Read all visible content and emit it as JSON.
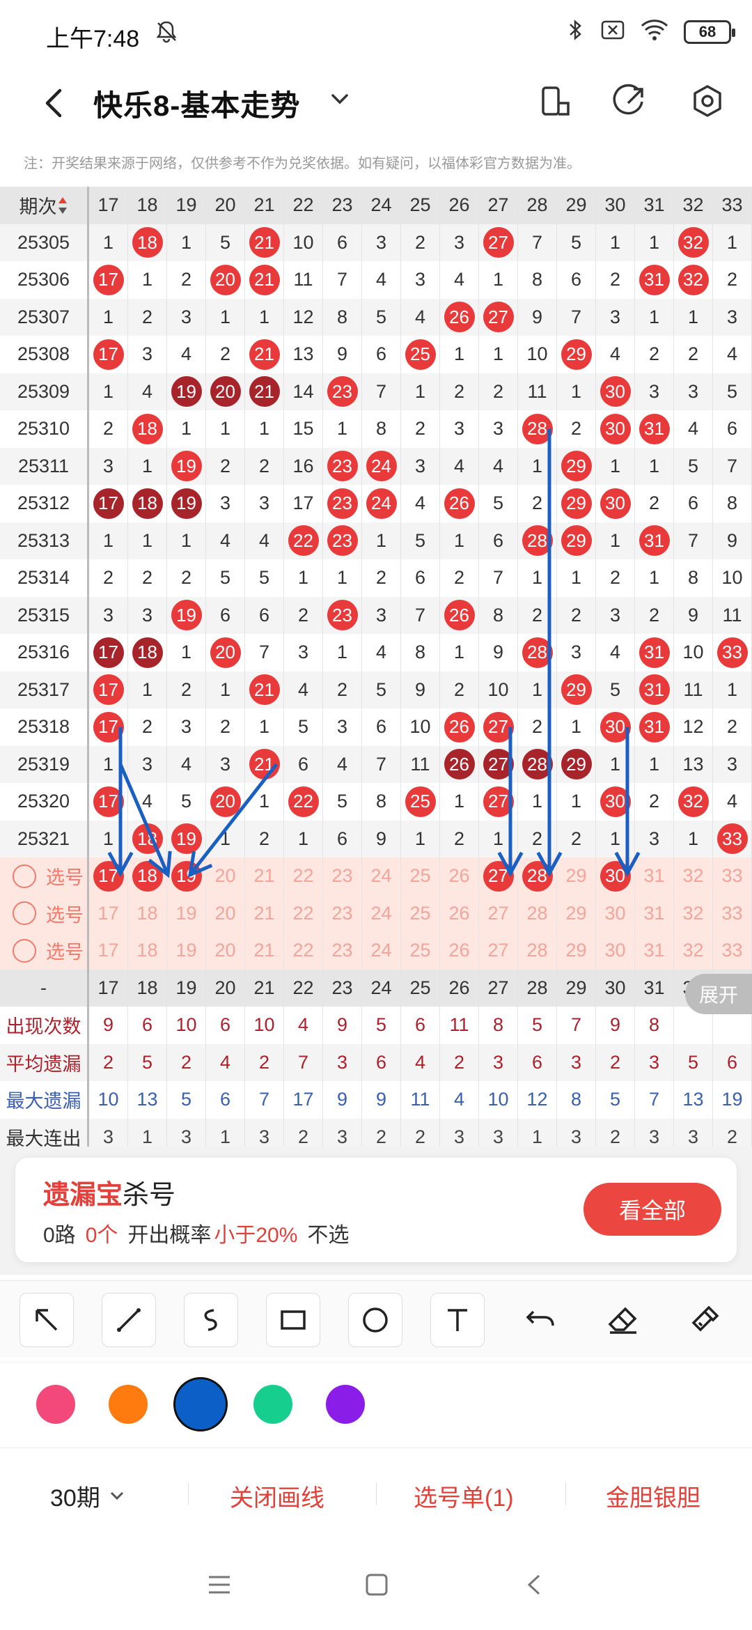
{
  "status": {
    "time": "上午7:48",
    "battery": "68"
  },
  "header": {
    "title": "快乐8-基本走势"
  },
  "note": "注：开奖结果来源于网络，仅供参考不作为兑奖依据。如有疑问，以福体彩官方数据为准。",
  "table": {
    "corner_label": "期次",
    "columns": [
      "17",
      "18",
      "19",
      "20",
      "21",
      "22",
      "23",
      "24",
      "25",
      "26",
      "27",
      "28",
      "29",
      "30",
      "31",
      "32",
      "33"
    ],
    "rows": [
      {
        "id": "25305",
        "cells": [
          "1",
          "18",
          "1",
          "5",
          "21",
          "10",
          "6",
          "3",
          "2",
          "3",
          "27",
          "7",
          "5",
          "1",
          "1",
          "32",
          "1"
        ]
      },
      {
        "id": "25306",
        "cells": [
          "17",
          "1",
          "2",
          "20",
          "21",
          "11",
          "7",
          "4",
          "3",
          "4",
          "1",
          "8",
          "6",
          "2",
          "31",
          "32",
          "2"
        ]
      },
      {
        "id": "25307",
        "cells": [
          "1",
          "2",
          "3",
          "1",
          "1",
          "12",
          "8",
          "5",
          "4",
          "26",
          "27",
          "9",
          "7",
          "3",
          "1",
          "1",
          "3"
        ]
      },
      {
        "id": "25308",
        "cells": [
          "17",
          "3",
          "4",
          "2",
          "21",
          "13",
          "9",
          "6",
          "25",
          "1",
          "1",
          "10",
          "29",
          "4",
          "2",
          "2",
          "4"
        ]
      },
      {
        "id": "25309",
        "cells": [
          "1",
          "4",
          "19",
          "20",
          "21",
          "14",
          "23",
          "7",
          "1",
          "2",
          "2",
          "11",
          "1",
          "30",
          "3",
          "3",
          "5"
        ]
      },
      {
        "id": "25310",
        "cells": [
          "2",
          "18",
          "1",
          "1",
          "1",
          "15",
          "1",
          "8",
          "2",
          "3",
          "3",
          "28",
          "2",
          "30",
          "31",
          "4",
          "6"
        ]
      },
      {
        "id": "25311",
        "cells": [
          "3",
          "1",
          "19",
          "2",
          "2",
          "16",
          "23",
          "24",
          "3",
          "4",
          "4",
          "1",
          "29",
          "1",
          "1",
          "5",
          "7"
        ]
      },
      {
        "id": "25312",
        "cells": [
          "17",
          "18",
          "19",
          "3",
          "3",
          "17",
          "23",
          "24",
          "4",
          "26",
          "5",
          "2",
          "29",
          "30",
          "2",
          "6",
          "8"
        ]
      },
      {
        "id": "25313",
        "cells": [
          "1",
          "1",
          "1",
          "4",
          "4",
          "22",
          "23",
          "1",
          "5",
          "1",
          "6",
          "28",
          "29",
          "1",
          "31",
          "7",
          "9"
        ]
      },
      {
        "id": "25314",
        "cells": [
          "2",
          "2",
          "2",
          "5",
          "5",
          "1",
          "1",
          "2",
          "6",
          "2",
          "7",
          "1",
          "1",
          "2",
          "1",
          "8",
          "10"
        ]
      },
      {
        "id": "25315",
        "cells": [
          "3",
          "3",
          "19",
          "6",
          "6",
          "2",
          "23",
          "3",
          "7",
          "26",
          "8",
          "2",
          "2",
          "3",
          "2",
          "9",
          "11"
        ]
      },
      {
        "id": "25316",
        "cells": [
          "17",
          "18",
          "1",
          "20",
          "7",
          "3",
          "1",
          "4",
          "8",
          "1",
          "9",
          "28",
          "3",
          "4",
          "31",
          "10",
          "33"
        ]
      },
      {
        "id": "25317",
        "cells": [
          "17",
          "1",
          "2",
          "1",
          "21",
          "4",
          "2",
          "5",
          "9",
          "2",
          "10",
          "1",
          "29",
          "5",
          "31",
          "11",
          "1"
        ]
      },
      {
        "id": "25318",
        "cells": [
          "17",
          "2",
          "3",
          "2",
          "1",
          "5",
          "3",
          "6",
          "10",
          "26",
          "27",
          "2",
          "1",
          "30",
          "31",
          "12",
          "2"
        ]
      },
      {
        "id": "25319",
        "cells": [
          "1",
          "3",
          "4",
          "3",
          "21",
          "6",
          "4",
          "7",
          "11",
          "26",
          "27",
          "28",
          "29",
          "1",
          "1",
          "13",
          "3"
        ]
      },
      {
        "id": "25320",
        "cells": [
          "17",
          "4",
          "5",
          "20",
          "1",
          "22",
          "5",
          "8",
          "25",
          "1",
          "27",
          "1",
          "1",
          "30",
          "2",
          "32",
          "4"
        ]
      },
      {
        "id": "25321",
        "cells": [
          "1",
          "18",
          "19",
          "1",
          "2",
          "1",
          "6",
          "9",
          "1",
          "2",
          "1",
          "2",
          "2",
          "1",
          "3",
          "1",
          "33"
        ]
      }
    ],
    "pick_rows": [
      {
        "label": "选号",
        "selected": [
          "17",
          "18",
          "19",
          "27",
          "28",
          "30"
        ]
      },
      {
        "label": "选号",
        "selected": []
      },
      {
        "label": "选号",
        "selected": []
      }
    ],
    "footer_header_label": "-",
    "stats": [
      {
        "label": "出现次数",
        "values": [
          "9",
          "6",
          "10",
          "6",
          "10",
          "4",
          "9",
          "5",
          "6",
          "11",
          "8",
          "5",
          "7",
          "9",
          "8",
          "",
          "",
          ""
        ]
      },
      {
        "label": "平均遗漏",
        "values": [
          "2",
          "5",
          "2",
          "4",
          "2",
          "7",
          "3",
          "6",
          "4",
          "2",
          "3",
          "6",
          "3",
          "2",
          "3",
          "5",
          "6"
        ]
      },
      {
        "label": "最大遗漏",
        "values": [
          "10",
          "13",
          "5",
          "6",
          "7",
          "17",
          "9",
          "9",
          "11",
          "4",
          "10",
          "12",
          "8",
          "5",
          "7",
          "13",
          "19"
        ]
      },
      {
        "label": "最大连出",
        "values": [
          "3",
          "1",
          "3",
          "1",
          "3",
          "2",
          "3",
          "2",
          "2",
          "3",
          "3",
          "1",
          "3",
          "2",
          "3",
          "3",
          "2"
        ]
      }
    ],
    "expand_label": "展开"
  },
  "promo": {
    "title_red": "遗漏宝",
    "title_black": "杀号",
    "road": "0路",
    "count": "0个",
    "prob_label": "开出概率",
    "prob_value": "小于20%",
    "tail": "不选",
    "button": "看全部"
  },
  "tools": [
    "arrow-tool",
    "line-tool",
    "curve-tool",
    "rect-tool",
    "circle-tool",
    "text-tool",
    "undo-tool",
    "eraser-tool",
    "clear-tool"
  ],
  "colors": [
    "#f2487a",
    "#ff7a0f",
    "#0b5fc7",
    "#16cf8f",
    "#8a1ee8"
  ],
  "bottombar": {
    "period": "30期",
    "close_line": "关闭画线",
    "pick_list": "选号单(1)",
    "gold": "金胆银胆"
  }
}
